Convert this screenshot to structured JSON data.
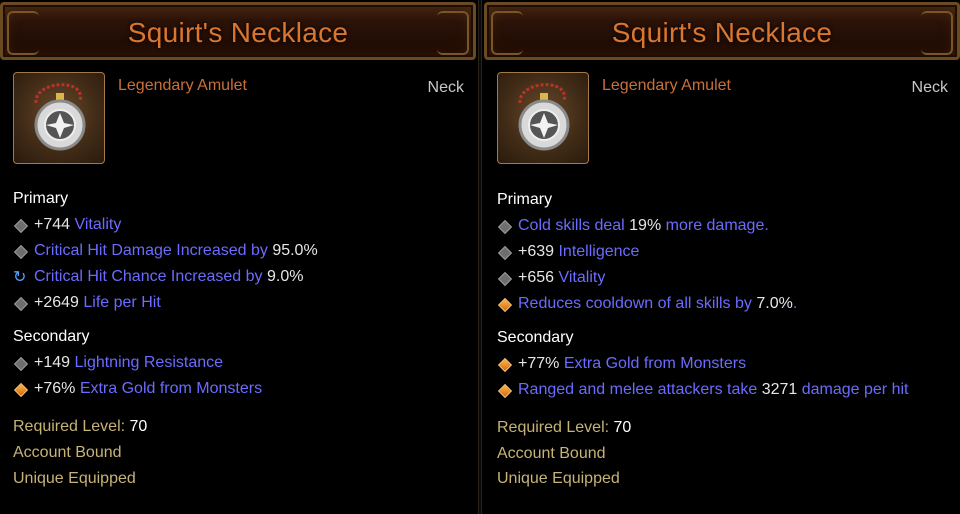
{
  "left": {
    "title": "Squirt's Necklace",
    "item_type": "Legendary Amulet",
    "slot": "Neck",
    "primary_heading": "Primary",
    "primary": [
      {
        "bullet": "diamond",
        "parts": [
          {
            "t": "+744 ",
            "c": "w"
          },
          {
            "t": "Vitality",
            "c": "b"
          }
        ]
      },
      {
        "bullet": "diamond",
        "parts": [
          {
            "t": "Critical Hit Damage Increased by ",
            "c": "b"
          },
          {
            "t": "95.0%",
            "c": "w"
          }
        ]
      },
      {
        "bullet": "cycle",
        "parts": [
          {
            "t": "Critical Hit Chance Increased by ",
            "c": "b"
          },
          {
            "t": "9.0%",
            "c": "w"
          }
        ]
      },
      {
        "bullet": "diamond",
        "parts": [
          {
            "t": "+2649 ",
            "c": "w"
          },
          {
            "t": "Life per Hit",
            "c": "b"
          }
        ]
      }
    ],
    "secondary_heading": "Secondary",
    "secondary": [
      {
        "bullet": "diamond",
        "parts": [
          {
            "t": "+149 ",
            "c": "w"
          },
          {
            "t": "Lightning Resistance",
            "c": "b"
          }
        ]
      },
      {
        "bullet": "diamond-orange",
        "parts": [
          {
            "t": "+76% ",
            "c": "w"
          },
          {
            "t": "Extra Gold from Monsters",
            "c": "b"
          }
        ]
      }
    ],
    "required_level_label": "Required Level: ",
    "required_level": "70",
    "account_bound": "Account Bound",
    "unique_equipped": "Unique Equipped"
  },
  "right": {
    "title": "Squirt's Necklace",
    "item_type": "Legendary Amulet",
    "slot": "Neck",
    "primary_heading": "Primary",
    "primary": [
      {
        "bullet": "diamond",
        "parts": [
          {
            "t": "Cold skills deal ",
            "c": "b"
          },
          {
            "t": "19%",
            "c": "w"
          },
          {
            "t": " more damage.",
            "c": "b"
          }
        ]
      },
      {
        "bullet": "diamond",
        "parts": [
          {
            "t": "+639 ",
            "c": "w"
          },
          {
            "t": "Intelligence",
            "c": "b"
          }
        ]
      },
      {
        "bullet": "diamond",
        "parts": [
          {
            "t": "+656 ",
            "c": "w"
          },
          {
            "t": "Vitality",
            "c": "b"
          }
        ]
      },
      {
        "bullet": "diamond-orange",
        "parts": [
          {
            "t": "Reduces cooldown of all skills by ",
            "c": "b"
          },
          {
            "t": "7.0%",
            "c": "w"
          },
          {
            "t": ".",
            "c": "b"
          }
        ]
      }
    ],
    "secondary_heading": "Secondary",
    "secondary": [
      {
        "bullet": "diamond-orange",
        "parts": [
          {
            "t": "+77% ",
            "c": "w"
          },
          {
            "t": "Extra Gold from Monsters",
            "c": "b"
          }
        ]
      },
      {
        "bullet": "diamond-orange",
        "parts": [
          {
            "t": "Ranged and melee attackers take ",
            "c": "b"
          },
          {
            "t": "3271",
            "c": "w"
          },
          {
            "t": " damage per hit",
            "c": "b"
          }
        ]
      }
    ],
    "required_level_label": "Required Level: ",
    "required_level": "70",
    "account_bound": "Account Bound",
    "unique_equipped": "Unique Equipped"
  },
  "colors": {
    "title": "#d9762f",
    "item_type": "#c9703a",
    "stat_value": "#e6e6e6",
    "stat_name": "#6b6bff",
    "footer": "#c7b377"
  },
  "icons": {
    "item": "amulet-icon",
    "bullet": "diamond-icon",
    "bullet_orange": "orange-diamond-icon",
    "bullet_cycle": "cycle-icon"
  }
}
